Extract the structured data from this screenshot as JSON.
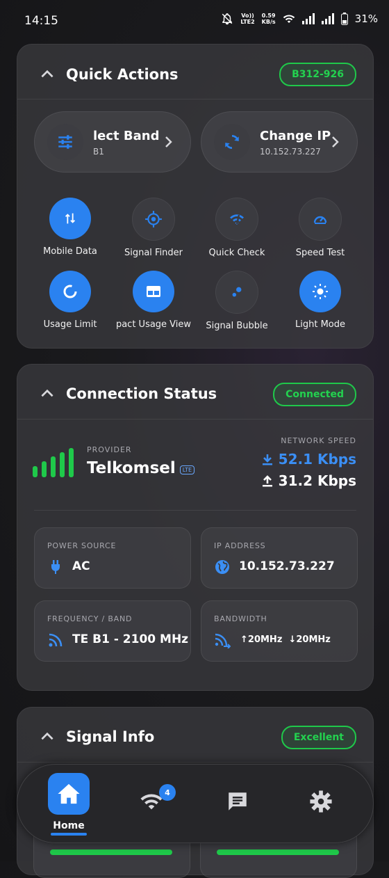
{
  "status_bar": {
    "time": "14:15",
    "volte_line1": "Vo))",
    "volte_line2": "LTE2",
    "net_speed_value": "0.59",
    "net_speed_unit": "KB/s",
    "battery": "31%"
  },
  "quick_actions": {
    "title": "Quick Actions",
    "device_badge": "B312-926",
    "select_band": {
      "label": "lect Band",
      "sub": "B1"
    },
    "change_ip": {
      "label": "Change IP",
      "sub": "10.152.73.227"
    },
    "items": [
      {
        "label": "Mobile Data",
        "active": true,
        "icon": "data-arrows-icon"
      },
      {
        "label": "Signal Finder",
        "active": false,
        "icon": "crosshair-icon"
      },
      {
        "label": "Quick Check",
        "active": false,
        "icon": "wifi-check-icon"
      },
      {
        "label": "Speed Test",
        "active": false,
        "icon": "speedometer-icon"
      },
      {
        "label": "Usage Limit",
        "active": true,
        "icon": "ring-icon"
      },
      {
        "label": "pact Usage View",
        "active": true,
        "icon": "layout-icon"
      },
      {
        "label": "Signal Bubble",
        "active": false,
        "icon": "bubbles-icon"
      },
      {
        "label": "Light Mode",
        "active": true,
        "icon": "sun-icon"
      }
    ]
  },
  "connection_status": {
    "title": "Connection Status",
    "status_badge": "Connected",
    "provider_label": "PROVIDER",
    "provider_name": "Telkomsel",
    "provider_tech": "LTE",
    "network_speed_label": "NETWORK SPEED",
    "download": "52.1 Kbps",
    "upload": "31.2 Kbps",
    "power_source_label": "POWER SOURCE",
    "power_source": "AC",
    "ip_label": "IP ADDRESS",
    "ip": "10.152.73.227",
    "frequency_label": "FREQUENCY / BAND",
    "frequency": "TE B1 - 2100 MHz",
    "bandwidth_label": "BANDWIDTH",
    "bandwidth_up": "20MHz",
    "bandwidth_down": "20MHz"
  },
  "signal_info": {
    "title": "Signal Info",
    "quality_badge": "Excellent"
  },
  "nav": {
    "home_label": "Home",
    "wifi_badge": "4"
  },
  "colors": {
    "accent": "#2a82f0",
    "success": "#1fc94a",
    "card_bg": "#3a3a3e"
  }
}
